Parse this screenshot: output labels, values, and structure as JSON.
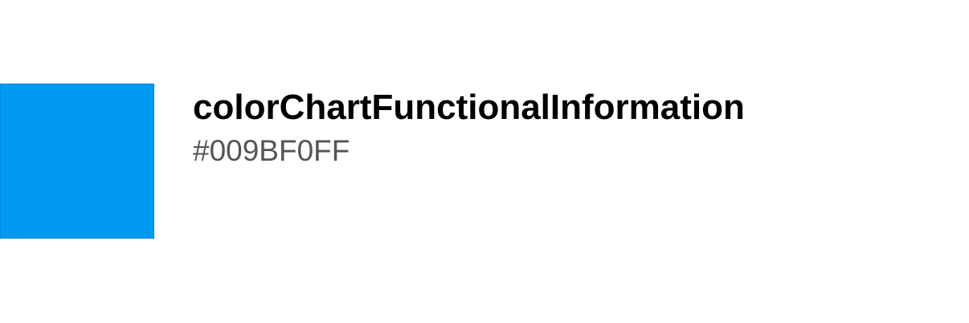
{
  "token": {
    "name": "colorChartFunctionalInformation",
    "value": "#009BF0FF",
    "swatch_color": "#009BF0"
  },
  "colors": {
    "name_text": "#000000",
    "value_text": "#555555",
    "background": "#ffffff"
  }
}
